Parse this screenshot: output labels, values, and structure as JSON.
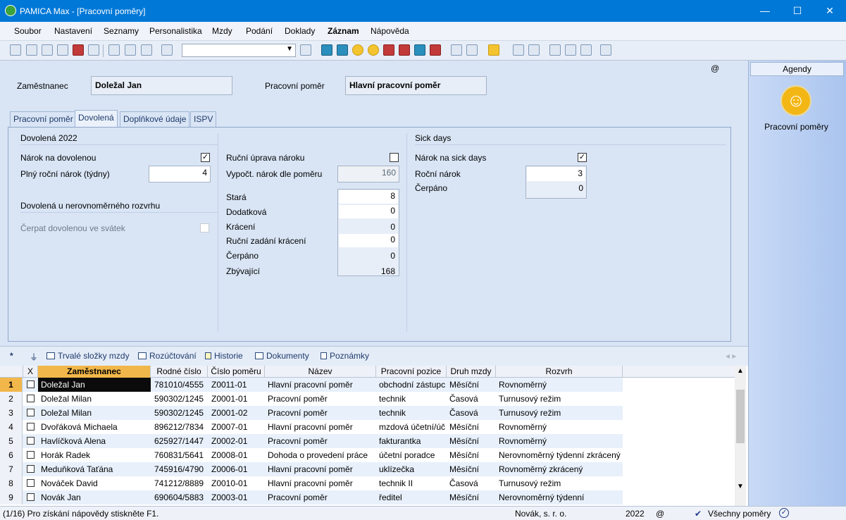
{
  "window": {
    "title": "PAMICA Max - [Pracovní poměry]"
  },
  "menu": [
    "Soubor",
    "Nastavení",
    "Seznamy",
    "Personalistika",
    "Mzdy",
    "Podání",
    "Doklady",
    "Záznam",
    "Nápověda"
  ],
  "header": {
    "employee_label": "Zaměstnanec",
    "employee_value": "Doležal Jan",
    "relation_label": "Pracovní poměr",
    "relation_value": "Hlavní pracovní poměr",
    "at": "@"
  },
  "tabs": [
    "Pracovní poměr",
    "Dovolená",
    "Doplňkové údaje",
    "ISPV"
  ],
  "vacation": {
    "section": "Dovolená 2022",
    "narok_label": "Nárok na dovolenou",
    "plny_label": "Plný roční nárok (týdny)",
    "plny_value": "4",
    "nerov_label": "Dovolená u nerovnoměrného rozvrhu",
    "svatek_label": "Čerpat dovolenou ve svátek",
    "rucni_label": "Ruční úprava nároku",
    "vypoct_label": "Vypočt. nárok dle poměru",
    "vypoct_value": "160",
    "stara_label": "Stará",
    "stara_value": "8",
    "dodatkova_label": "Dodatková",
    "dodatkova_value": "0",
    "kraceni_label": "Krácení",
    "kraceni_value": "0",
    "rucni_kraceni_label": "Ruční zadání krácení",
    "rucni_kraceni_value": "0",
    "cerpano_label": "Čerpáno",
    "cerpano_value": "0",
    "zbyva_label": "Zbývající",
    "zbyva_value": "168"
  },
  "sick": {
    "section": "Sick days",
    "narok_label": "Nárok na sick days",
    "rocni_label": "Roční nárok",
    "rocni_value": "3",
    "cerpano_label": "Čerpáno",
    "cerpano_value": "0"
  },
  "agendy": {
    "header": "Agendy",
    "item": "Pracovní poměry"
  },
  "bottom_tabs": [
    "Trvalé složky mzdy",
    "Rozúčtování",
    "Historie",
    "Dokumenty",
    "Poznámky"
  ],
  "grid": {
    "columns": [
      "X",
      "Zaměstnanec",
      "Rodné číslo",
      "Číslo poměru",
      "Název",
      "Pracovní pozice",
      "Druh mzdy",
      "Rozvrh"
    ],
    "rows": [
      [
        "1",
        "Doležal Jan",
        "781010/4555",
        "Z0011-01",
        "Hlavní pracovní poměr",
        "obchodní zástupce",
        "Měsíční",
        "Rovnoměrný"
      ],
      [
        "2",
        "Doležal Milan",
        "590302/1245",
        "Z0001-01",
        "Pracovní poměr",
        "technik",
        "Časová",
        "Turnusový režim"
      ],
      [
        "3",
        "Doležal Milan",
        "590302/1245",
        "Z0001-02",
        "Pracovní poměr",
        "technik",
        "Časová",
        "Turnusový režim"
      ],
      [
        "4",
        "Dvořáková Michaela",
        "896212/7834",
        "Z0007-01",
        "Hlavní pracovní poměr",
        "mzdová účetní/účetní",
        "Měsíční",
        "Rovnoměrný"
      ],
      [
        "5",
        "Havlíčková Alena",
        "625927/1447",
        "Z0002-01",
        "Pracovní poměr",
        "fakturantka",
        "Měsíční",
        "Rovnoměrný"
      ],
      [
        "6",
        "Horák Radek",
        "760831/5641",
        "Z0008-01",
        "Dohoda o provedení práce",
        "účetní poradce",
        "Měsíční",
        "Nerovnoměrný týdenní zkrácený"
      ],
      [
        "7",
        "Meduňková Taťána",
        "745916/4790",
        "Z0006-01",
        "Hlavní pracovní poměr",
        "uklízečka",
        "Měsíční",
        "Rovnoměrný zkrácený"
      ],
      [
        "8",
        "Nováček David",
        "741212/8889",
        "Z0010-01",
        "Hlavní pracovní poměr",
        "technik II",
        "Časová",
        "Turnusový režim"
      ],
      [
        "9",
        "Novák Jan",
        "690604/5883",
        "Z0003-01",
        "Pracovní poměr",
        "ředitel",
        "Měsíční",
        "Nerovnoměrný týdenní"
      ]
    ]
  },
  "status": {
    "help": "(1/16) Pro získání nápovědy stiskněte F1.",
    "company": "Novák, s. r. o.",
    "year": "2022",
    "at": "@",
    "filter": "Všechny poměry"
  }
}
